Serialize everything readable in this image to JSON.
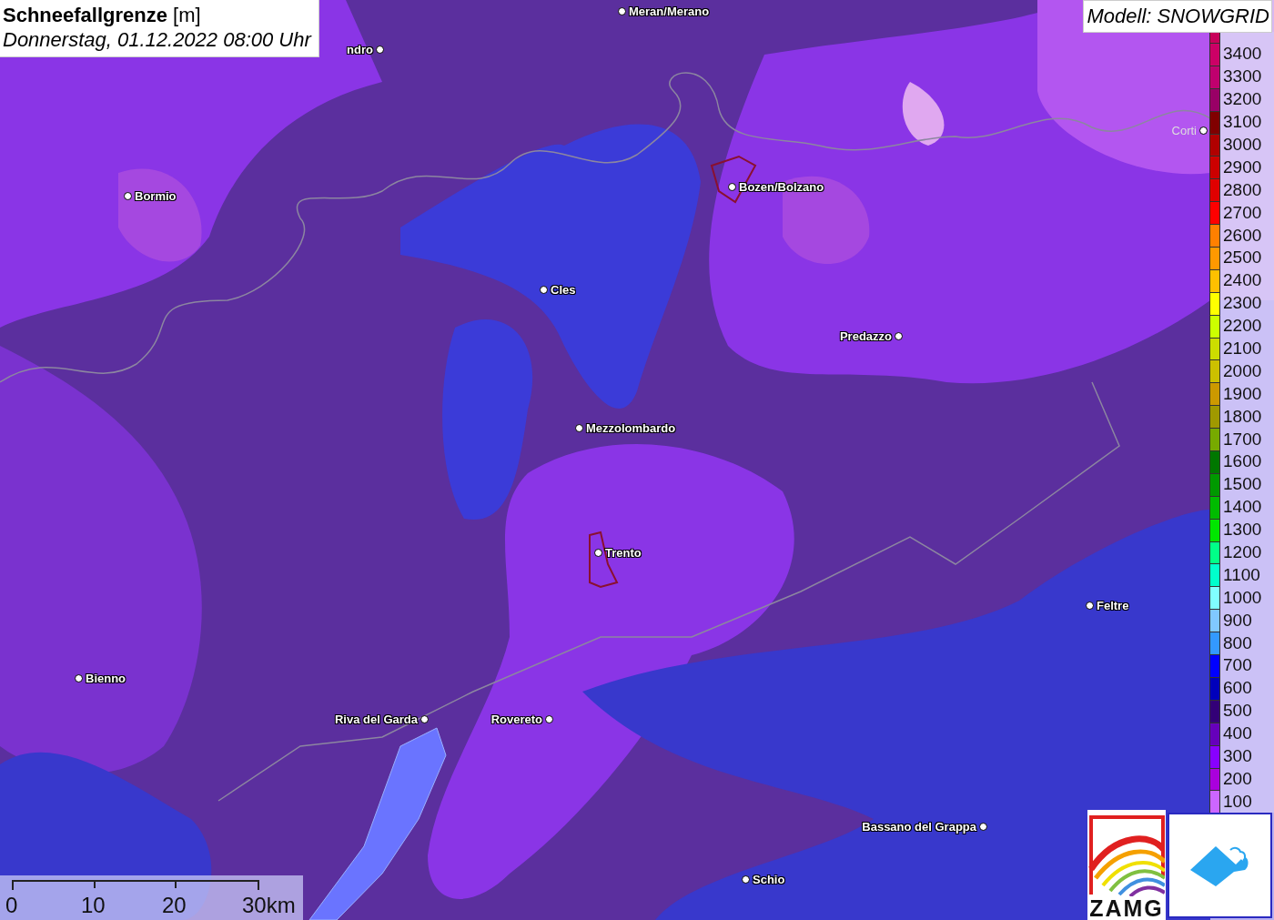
{
  "title": {
    "heading": "**Schneefallgrenze** [m]",
    "time": "Donnerstag, 01.12.2022 08:00 Uhr"
  },
  "model": "Modell: SNOWGRID",
  "legend": [
    {
      "color": "#c8005a"
    },
    {
      "label": "3400",
      "color": "#cc0066"
    },
    {
      "label": "3300",
      "color": "#c0006e"
    },
    {
      "label": "3200",
      "color": "#990066"
    },
    {
      "label": "3100",
      "color": "#800000"
    },
    {
      "label": "3000",
      "color": "#b00000"
    },
    {
      "label": "2900",
      "color": "#cc0000"
    },
    {
      "label": "2800",
      "color": "#e00000"
    },
    {
      "label": "2700",
      "color": "#ff0000"
    },
    {
      "label": "2600",
      "color": "#ff8000"
    },
    {
      "label": "2500",
      "color": "#ff9900"
    },
    {
      "label": "2400",
      "color": "#ffc000"
    },
    {
      "label": "2300",
      "color": "#ffff00"
    },
    {
      "label": "2200",
      "color": "#ccff00"
    },
    {
      "label": "2100",
      "color": "#ccdd00"
    },
    {
      "label": "2000",
      "color": "#ccc000"
    },
    {
      "label": "1900",
      "color": "#cc9900"
    },
    {
      "label": "1800",
      "color": "#a09900"
    },
    {
      "label": "1700",
      "color": "#77aa00"
    },
    {
      "label": "1600",
      "color": "#007700"
    },
    {
      "label": "1500",
      "color": "#009900"
    },
    {
      "label": "1400",
      "color": "#00bb00"
    },
    {
      "label": "1300",
      "color": "#00e600"
    },
    {
      "label": "1200",
      "color": "#00ff88"
    },
    {
      "label": "1100",
      "color": "#00ffcc"
    },
    {
      "label": "1000",
      "color": "#80ffff"
    },
    {
      "label": "900",
      "color": "#80c8ff"
    },
    {
      "label": "800",
      "color": "#3399ff"
    },
    {
      "label": "700",
      "color": "#0000ff"
    },
    {
      "label": "600",
      "color": "#0000bb"
    },
    {
      "label": "500",
      "color": "#330077"
    },
    {
      "label": "400",
      "color": "#6600bb"
    },
    {
      "label": "300",
      "color": "#8800ff"
    },
    {
      "label": "200",
      "color": "#aa00dd"
    },
    {
      "label": "100",
      "color": "#cc66ff"
    }
  ],
  "cities": [
    {
      "name": "Meran/Merano"
    },
    {
      "name": "ndro"
    },
    {
      "name": "Bormio"
    },
    {
      "name": "Bozen/Bolzano"
    },
    {
      "name": "Cles"
    },
    {
      "name": "Predazzo"
    },
    {
      "name": "Mezzolombardo"
    },
    {
      "name": "Trento"
    },
    {
      "name": "Feltre"
    },
    {
      "name": "Bienno"
    },
    {
      "name": "Riva del Garda"
    },
    {
      "name": "Rovereto"
    },
    {
      "name": "Bassano del Grappa"
    },
    {
      "name": "Schio"
    },
    {
      "name": "Corti"
    }
  ],
  "scale_bar": [
    "0",
    "10",
    "20",
    "30km"
  ],
  "logo_text": "ZAMG"
}
